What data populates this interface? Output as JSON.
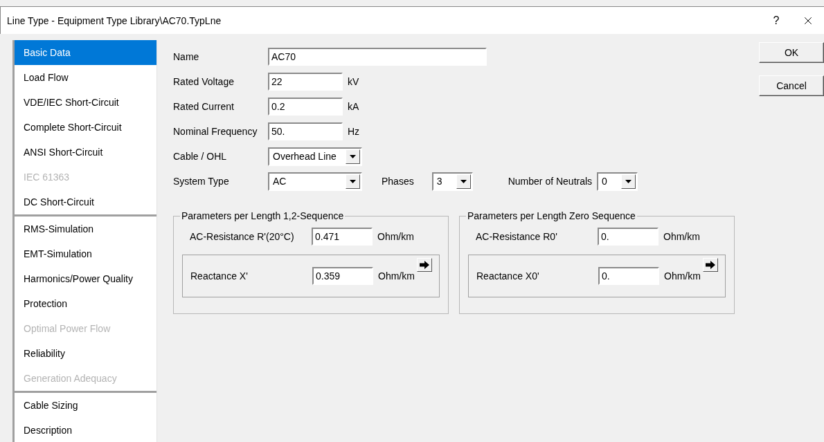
{
  "window": {
    "title": "Line Type - Equipment Type Library\\AC70.TypLne",
    "help": "?"
  },
  "sidebar": {
    "groups": [
      [
        {
          "label": "Basic Data",
          "selected": true,
          "disabled": false
        },
        {
          "label": "Load Flow",
          "selected": false,
          "disabled": false
        },
        {
          "label": "VDE/IEC Short-Circuit",
          "selected": false,
          "disabled": false
        },
        {
          "label": "Complete Short-Circuit",
          "selected": false,
          "disabled": false
        },
        {
          "label": "ANSI Short-Circuit",
          "selected": false,
          "disabled": false
        },
        {
          "label": "IEC 61363",
          "selected": false,
          "disabled": true
        },
        {
          "label": "DC Short-Circuit",
          "selected": false,
          "disabled": false
        }
      ],
      [
        {
          "label": "RMS-Simulation",
          "selected": false,
          "disabled": false
        },
        {
          "label": "EMT-Simulation",
          "selected": false,
          "disabled": false
        },
        {
          "label": "Harmonics/Power Quality",
          "selected": false,
          "disabled": false
        },
        {
          "label": "Protection",
          "selected": false,
          "disabled": false
        },
        {
          "label": "Optimal Power Flow",
          "selected": false,
          "disabled": true
        },
        {
          "label": "Reliability",
          "selected": false,
          "disabled": false
        },
        {
          "label": "Generation Adequacy",
          "selected": false,
          "disabled": true
        }
      ],
      [
        {
          "label": "Cable Sizing",
          "selected": false,
          "disabled": false
        },
        {
          "label": "Description",
          "selected": false,
          "disabled": false
        }
      ]
    ]
  },
  "rows": [
    [
      {
        "kind": "wide",
        "label": "Name",
        "value": "AC70"
      }
    ],
    [
      {
        "kind": "number",
        "label": "Rated Voltage",
        "value": "22",
        "unit": "kV"
      }
    ],
    [
      {
        "kind": "number",
        "label": "Rated Current",
        "value": "0.2",
        "unit": "kA"
      }
    ],
    [
      {
        "kind": "number",
        "label": "Nominal Frequency",
        "value": "50.",
        "unit": "Hz"
      }
    ],
    [
      {
        "kind": "select",
        "label": "Cable / OHL",
        "value": "Overhead Line"
      }
    ],
    [
      {
        "kind": "select",
        "label": "System Type",
        "value": "AC"
      },
      {
        "kind": "small_select",
        "label": "Phases",
        "value": "3"
      },
      {
        "kind": "small_select",
        "label": "Number of Neutrals",
        "value": "0"
      }
    ]
  ],
  "sections": [
    {
      "title": "Parameters per Length 1,2-Sequence",
      "resistance": {
        "label": "AC-Resistance R'(20°C)",
        "value": "0.471",
        "unit": "Ohm/km"
      },
      "reactance": {
        "label": "Reactance X'",
        "value": "0.359",
        "unit": "Ohm/km"
      }
    },
    {
      "title": "Parameters per Length Zero Sequence",
      "resistance": {
        "label": "AC-Resistance R0'",
        "value": "0.",
        "unit": "Ohm/km"
      },
      "reactance": {
        "label": "Reactance X0'",
        "value": "0.",
        "unit": "Ohm/km"
      }
    }
  ],
  "buttons": [
    "OK",
    "Cancel"
  ]
}
